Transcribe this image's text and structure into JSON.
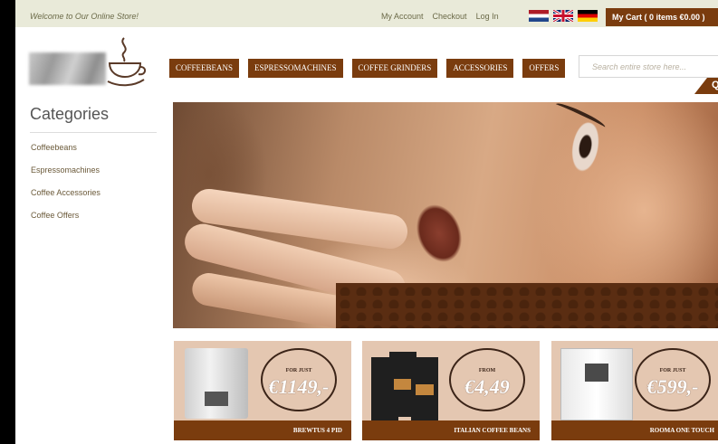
{
  "topbar": {
    "welcome": "Welcome to Our Online Store!",
    "links": [
      "My Account",
      "Checkout",
      "Log In"
    ],
    "languages": [
      "nl-flag",
      "uk-flag",
      "de-flag"
    ],
    "cart_label": "My Cart ( 0 items €0.00 )"
  },
  "nav": {
    "items": [
      "COFFEEBEANS",
      "ESPRESSOMACHINES",
      "COFFEE GRINDERS",
      "ACCESSORIES",
      "OFFERS"
    ]
  },
  "search": {
    "placeholder": "Search entire store here...",
    "button_label": "Q"
  },
  "sidebar": {
    "title": "Categories",
    "items": [
      "Coffeebeans",
      "Espressomachines",
      "Coffee Accessories",
      "Coffee Offers"
    ]
  },
  "promos": [
    {
      "tag": "FOR JUST",
      "price": "€1149,-",
      "caption": "BREWTUS 4 PID"
    },
    {
      "tag": "FROM",
      "price": "€4,49",
      "caption": "ITALIAN COFFEE BEANS"
    },
    {
      "tag": "FOR JUST",
      "price": "€599,-",
      "caption": "ROOMA ONE TOUCH"
    }
  ],
  "colors": {
    "brand_brown": "#7a3c0e",
    "topbar_bg": "#e9ead9",
    "tile_bg": "#e4c7b1"
  }
}
